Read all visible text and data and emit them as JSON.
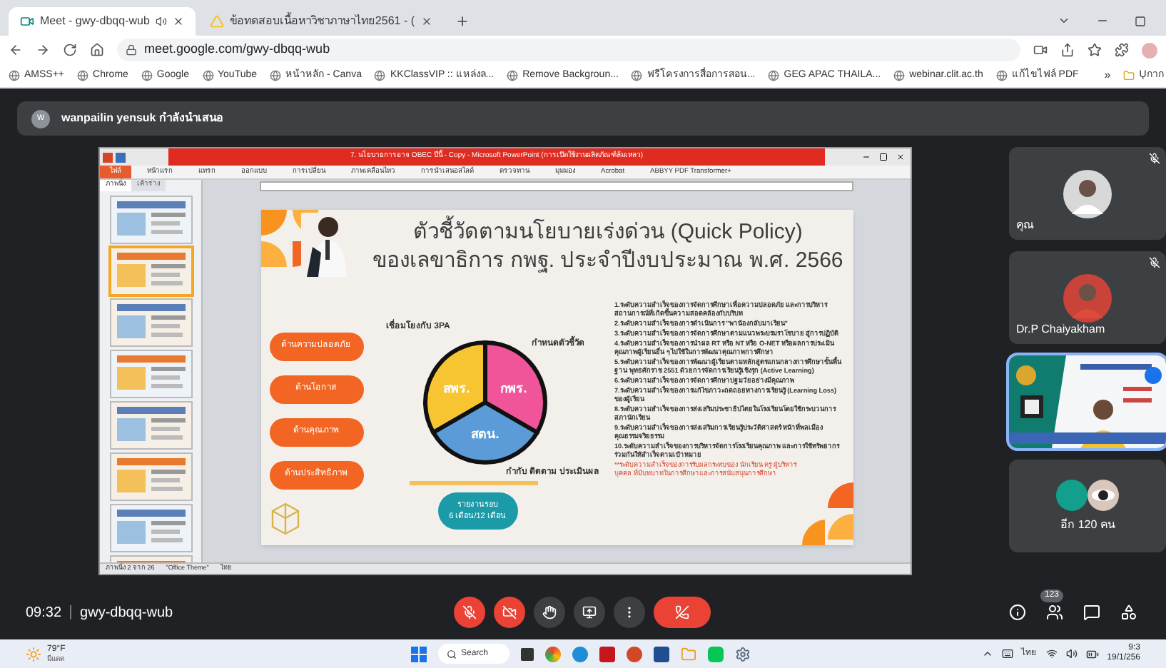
{
  "browser": {
    "tabs": [
      {
        "title": "Meet - gwy-dbqq-wub",
        "selected": true,
        "kind": "meet"
      },
      {
        "title": "ข้อทดสอบเนื้อหาวิชาภาษาไทย2561 - (",
        "selected": false,
        "kind": "drive"
      }
    ],
    "url": "meet.google.com/gwy-dbqq-wub",
    "bookmarks": [
      "AMSS++",
      "Chrome",
      "Google",
      "YouTube",
      "หน้าหลัก - Canva",
      "KKClassVIP :: แหล่งล...",
      "Remove Backgroun...",
      "ฟรีโครงการสื่อการสอน...",
      "GEG APAC THAILA...",
      "webinar.clit.ac.th",
      "แก้ไขไฟล์ PDF"
    ],
    "more_bookmarks": "»",
    "other_bookmarks": "Ųกาก"
  },
  "presenter": {
    "initial": "w",
    "text": "wanpailin yensuk กำลังนำเสนอ"
  },
  "powerpoint": {
    "title": "7. นโยบายการอาจ OBEC ปีนี้ - Copy - Microsoft PowerPoint (การเปิดใช้งานผลิตภัณฑ์ล้มเหลว)",
    "ribbon_tabs": [
      {
        "label": "ไฟล์",
        "selected": true
      },
      {
        "label": "หน้าแรก",
        "selected": false
      },
      {
        "label": "แทรก",
        "selected": false
      },
      {
        "label": "ออกแบบ",
        "selected": false
      },
      {
        "label": "การเปลี่ยน",
        "selected": false
      },
      {
        "label": "ภาพเคลื่อนไหว",
        "selected": false
      },
      {
        "label": "การนำเสนอสไลด์",
        "selected": false
      },
      {
        "label": "ตรวจทาน",
        "selected": false
      },
      {
        "label": "มุมมอง",
        "selected": false
      },
      {
        "label": "Acrobat",
        "selected": false
      },
      {
        "label": "ABBYY PDF Transformer+",
        "selected": false
      }
    ],
    "panel_tabs": [
      {
        "label": "ภาพนิ่ง",
        "selected": true
      },
      {
        "label": "เค้าร่าง",
        "selected": false
      }
    ],
    "thumbnails": [
      {
        "selected": false
      },
      {
        "selected": true
      },
      {
        "selected": false
      },
      {
        "selected": false
      },
      {
        "selected": false
      },
      {
        "selected": false
      },
      {
        "selected": false
      },
      {
        "selected": false
      }
    ],
    "status": [
      "ภาพนิ่ง 2 จาก 26",
      "\"Office Theme\"",
      "ไทย"
    ]
  },
  "slide": {
    "title_lines": [
      "ตัวชี้วัดตามนโยบายเร่งด่วน (Quick Policy)",
      "ของเลขาธิการ กพฐ. ประจำปีงบประมาณ พ.ศ. 2566"
    ],
    "aspects": [
      "ด้านความปลอดภัย",
      "ด้านโอกาส",
      "ด้านคุณภาพ",
      "ด้านประสิทธิภาพ"
    ],
    "link_label": "เชื่อมโยงกับ 3PA",
    "define_label": "กำหนดตัวชี้วัด",
    "follow_label": "กำกับ ติดตาม ประเมินผล",
    "pie": [
      {
        "label": "สพร.",
        "color": "#f7c531"
      },
      {
        "label": "กพร.",
        "color": "#f0559a"
      },
      {
        "label": "สตน.",
        "color": "#5b9bd8"
      }
    ],
    "report_lines": [
      "รายงานรอบ",
      "6 เดือน/12 เดือน"
    ],
    "indicators": [
      "1.ระดับความสำเร็จของการจัดการศึกษาเพื่อความปลอดภัย และการบริหารสถานการณ์ที่เกิดขึ้นความสอดคล้องกับบริบท",
      "2.ระดับความสำเร็จของการดำเนินการ \"พาน้องกลับมาเรียน\"",
      "3.ระดับความสำเร็จของการจัดการศึกษาตามแนวพระบรมราโชบาย สู่การปฏิบัติ",
      "4.ระดับความสำเร็จของการนำผล RT หรือ NT หรือ O-NET หรือผลการประเมินคุณภาพผู้เรียนอื่น ๆ ไปใช้ในการพัฒนาคุณภาพการศึกษา",
      "5.ระดับความสำเร็จของการพัฒนาผู้เรียนตามหลักสูตรแกนกลางการศึกษาขั้นพื้นฐาน พุทธศักราช 2551 ด้วยการจัดการเรียนรู้เชิงรุก (Active Learning)",
      "6.ระดับความสำเร็จของการจัดการศึกษาปฐมวัยอย่างมีคุณภาพ",
      "7.ระดับความสำเร็จของการแก้ไขภาวะถดถอยทางการเรียนรู้ (Learning Loss) ของผู้เรียน",
      "8.ระดับความสำเร็จของการส่งเสริมประชาธิปไตยในโรงเรียนโดยใช้กระบวนการสภานักเรียน",
      "9.ระดับความสำเร็จของการส่งเสริมการเรียนรู้ประวัติศาสตร์ หน้าที่พลเมือง คุณธรรมจริยธรรม",
      "10.ระดับความสำเร็จของการบริหารจัดการโรงเรียนคุณภาพ และการใช้ทรัพยากรร่วมกันให้สำเร็จตามเป้าหมาย"
    ],
    "footnote": "**ระดับความสำเร็จของการรับผลกระทบของ นักเรียน ครู ผู้บริหาร บุคคล ที่มีบทบาทในการศึกษาและการสนับสนุนการศึกษา"
  },
  "participants": [
    {
      "kind": "avatar",
      "name": "คุณ",
      "muted": true,
      "speaking": false
    },
    {
      "kind": "avatar",
      "name": "Dr.P Chaiyakham",
      "muted": true,
      "speaking": false
    },
    {
      "kind": "video",
      "muted": false,
      "speaking": true
    },
    {
      "kind": "others",
      "name": "อีก 120 คน",
      "muted": false,
      "speaking": false
    }
  ],
  "meeting": {
    "time": "09:32",
    "code": "gwy-dbqq-wub",
    "controls": [
      {
        "kind": "mic",
        "on": false
      },
      {
        "kind": "camera",
        "on": false
      },
      {
        "kind": "hand"
      },
      {
        "kind": "present"
      },
      {
        "kind": "more"
      },
      {
        "kind": "hangup"
      }
    ],
    "people_count": "123"
  },
  "taskbar": {
    "temperature": "79°F",
    "weather": "มีแดด",
    "search": "Search",
    "language": "ไทย",
    "time": "9:3",
    "date": "19/1/256"
  }
}
